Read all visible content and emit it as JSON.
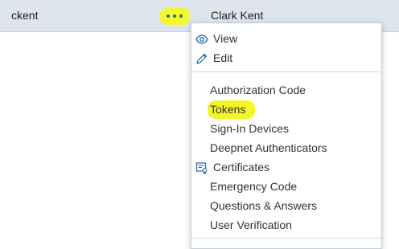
{
  "row": {
    "username": "ckent",
    "display_name": "Clark Kent"
  },
  "menu": {
    "view_label": "View",
    "edit_label": "Edit",
    "items": [
      "Authorization Code",
      "Tokens",
      "Sign-In Devices",
      "Deepnet Authenticators",
      "Certificates",
      "Emergency Code",
      "Questions & Answers",
      "User Verification"
    ]
  },
  "icons": {
    "view": "eye-icon",
    "edit": "pencil-icon",
    "certificates": "certificate-icon",
    "more": "more-actions-icon"
  },
  "colors": {
    "highlight": "#f3f52a",
    "dots": "#1d7a3e",
    "icon_accent": "#2f6fb5",
    "row_background": "#dfe5ee"
  }
}
